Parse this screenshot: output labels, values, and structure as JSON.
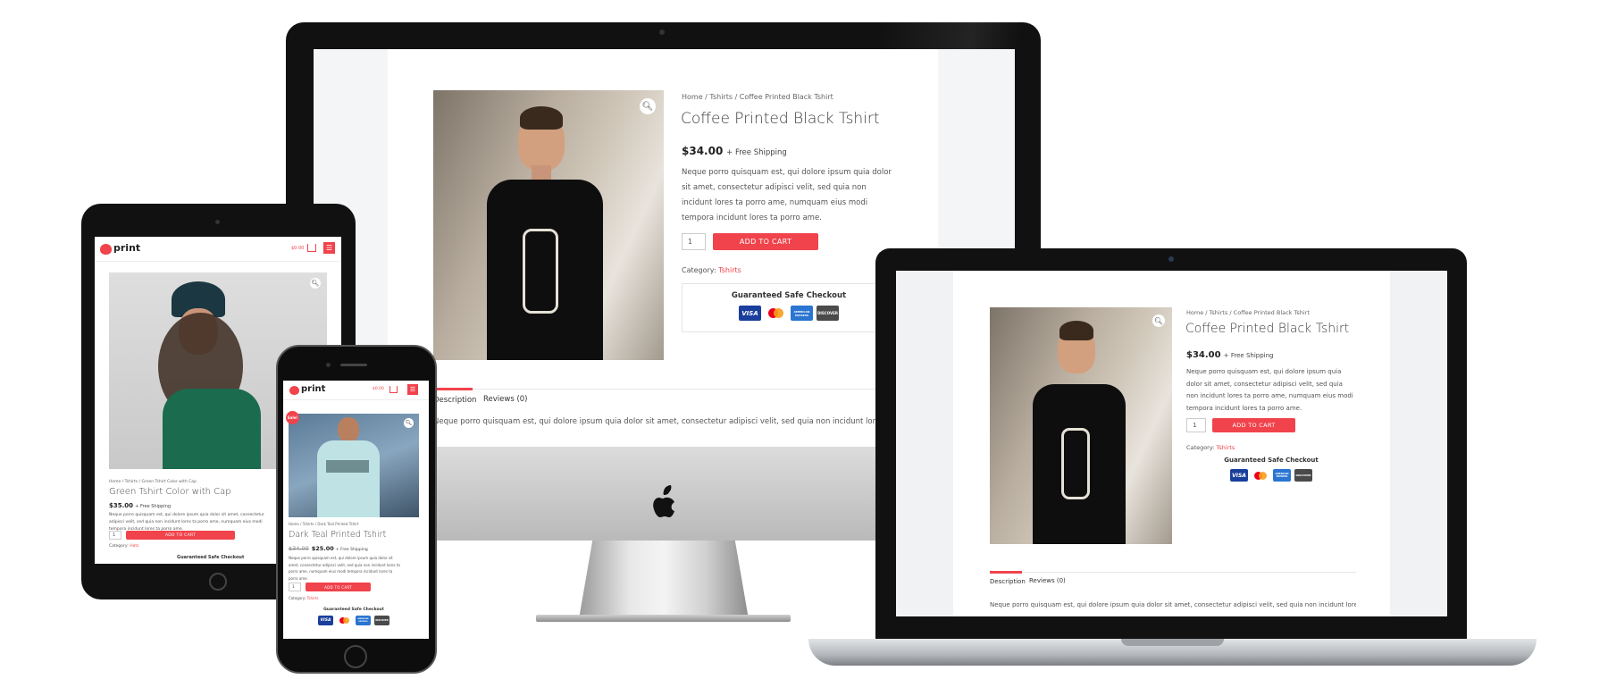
{
  "product": {
    "breadcrumb": "Home / Tshirts / Coffee Printed Black Tshirt",
    "title": "Coffee Printed Black Tshirt",
    "price": "$34.00",
    "shipping": "+ Free Shipping",
    "description": "Neque porro quisquam est, qui dolore ipsum quia dolor sit amet, consectetur adipisci velit, sed quia non incidunt lores ta porro ame, numquam eius modi tempora incidunt lores ta porro ame.",
    "quantity": "1",
    "add_to_cart": "ADD TO CART",
    "category_label": "Category:",
    "category_value": "Tshirts",
    "safe_checkout": "Guaranteed Safe Checkout",
    "tab_description": "Description",
    "tab_reviews": "Reviews (0)",
    "tab_content": "Neque porro quisquam est, qui dolore ipsum quia dolor sit amet, consectetur adipisci velit, sed quia non incidunt lores ta porro ame"
  },
  "cards": {
    "visa": "VISA",
    "amex": "AMERICAN EXPRESS",
    "discover": "DISCOVER"
  },
  "tablet": {
    "logo": "print",
    "cart_total": "$0.00",
    "breadcrumb": "Home / Tshirts / Green Tshirt Color with Cap",
    "title": "Green Tshirt Color with Cap",
    "price": "$35.00",
    "shipping": "+ Free Shipping",
    "description": "Neque porro quisquam est, qui dolore ipsum quia dolor sit amet, consectetur adipisci velit, sed quia non incidunt lores ta porro ame, numquam eius modi tempora incidunt lores ta porro ame.",
    "quantity": "1",
    "add_to_cart": "ADD TO CART",
    "category_label": "Category:",
    "category_value": "Hats",
    "safe_checkout": "Guaranteed Safe Checkout"
  },
  "phone": {
    "logo": "print",
    "cart_total": "$0.00",
    "sale_badge": "Sale!",
    "breadcrumb": "Home / Tshirts / Dark Teal Printed Tshirt",
    "title": "Dark Teal Printed Tshirt",
    "price_old": "$34.00",
    "price": "$25.00",
    "shipping": "+ Free Shipping",
    "description": "Neque porro quisquam est, qui dolore ipsum quia dolor sit amet, consectetur adipisci velit, sed quia non incidunt lores ta porro ame, numquam eius modi tempora incidunt lores ta porro ame.",
    "quantity": "1",
    "add_to_cart": "ADD TO CART",
    "category_label": "Category:",
    "category_value": "Tshirts",
    "safe_checkout": "Guaranteed Safe Checkout"
  },
  "colors": {
    "accent": "#f0434c",
    "device_dark": "#111111",
    "laptop_silver": "#c7c9cc"
  }
}
